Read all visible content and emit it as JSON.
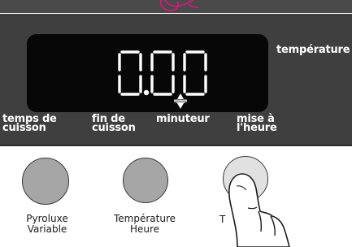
{
  "display": {
    "time": "0.00"
  },
  "labels": {
    "temperature": "température",
    "temps_de_cuisson": [
      "temps de",
      "cuisson"
    ],
    "fin_de_cuisson": [
      "fin de",
      "cuisson"
    ],
    "minuteur": "minuteur",
    "mise_a_lheure": [
      "mise à",
      "l'heure"
    ]
  },
  "buttons": [
    {
      "label_lines": [
        "Pyroluxe",
        "Variable"
      ]
    },
    {
      "label_lines": [
        "Température",
        "Heure"
      ]
    },
    {
      "label_lines": [
        "T"
      ]
    }
  ],
  "colors": {
    "panel": "#3f3f3f",
    "display_bg": "#070707",
    "segment": "#ffffff",
    "knob": "#a6a6a6",
    "knob_pressed": "#e1e1e1",
    "annotation": "#e0157a"
  },
  "icons": {
    "minuteur_indicator": "star-burst-icon",
    "hand": "pointing-finger-icon",
    "top_mark": "pink-annotation-icon"
  }
}
